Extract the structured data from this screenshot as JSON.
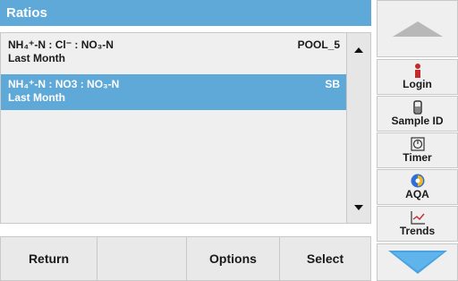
{
  "title": "Ratios",
  "list": {
    "items": [
      {
        "line1": "NH₄⁺-N : Cl⁻ : NO₃-N",
        "line2": "Last Month",
        "tag": "POOL_5",
        "selected": false
      },
      {
        "line1": "NH₄⁺-N : NO3 : NO₃-N",
        "line2": "Last Month",
        "tag": "SB",
        "selected": true
      }
    ]
  },
  "sidebar": {
    "up_icon": "triangle-up-icon",
    "down_icon": "chevron-down-icon",
    "buttons": [
      {
        "label": "Login",
        "icon": "person-icon"
      },
      {
        "label": "Sample ID",
        "icon": "sample-bottle-icon"
      },
      {
        "label": "Timer",
        "icon": "timer-icon"
      },
      {
        "label": "AQA",
        "icon": "aqa-icon"
      },
      {
        "label": "Trends",
        "icon": "trends-chart-icon"
      }
    ]
  },
  "bottom": {
    "return_label": "Return",
    "blank_label": "",
    "options_label": "Options",
    "select_label": "Select"
  },
  "colors": {
    "accent": "#5fa9d9",
    "down_arrow": "#4aa3e0",
    "background": "#efefef"
  }
}
